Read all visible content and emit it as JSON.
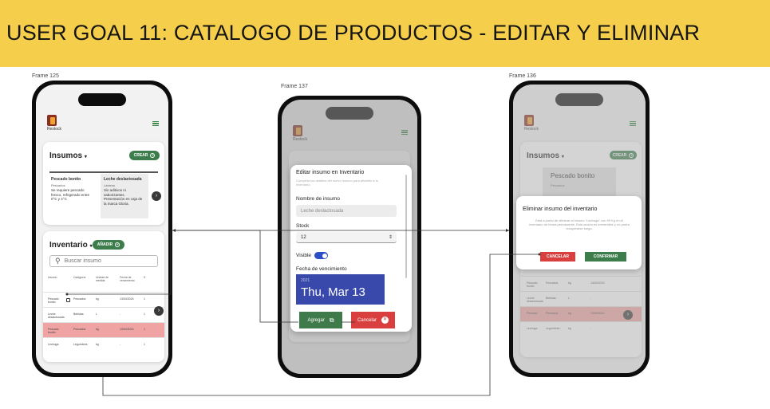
{
  "banner": {
    "title": "USER GOAL 11: CATALOGO DE PRODUCTOS - EDITAR Y ELIMINAR"
  },
  "frames": {
    "frame1_label": "Frame 125",
    "frame2_label": "Frame 137",
    "frame3_label": "Frame 136"
  },
  "app": {
    "logo_text": "Restock"
  },
  "screen1": {
    "insumos_title": "Insumos",
    "crear_label": "CREAR",
    "card1_title": "Pescado bonito",
    "card1_category": "Pescados",
    "card1_desc": "Se requiere pescado fresco, refrigerado entre 0°C y 4°C",
    "card2_title": "Leche deslactosada",
    "card2_category": "Lácteos",
    "card2_desc": "Sin aditivos ni saborizantes. Presentación en caja de la marca Gloria.",
    "inventario_title": "Inventario",
    "anadir_label": "AÑADIR",
    "search_placeholder": "Buscar insumo",
    "table_headers": [
      "Insumo",
      "Categoría",
      "Unidad de medida",
      "Fecha de vencimiento",
      "S"
    ],
    "rows": [
      {
        "insumo": "Pescado bonito",
        "categoria": "Pescados",
        "unidad": "kg",
        "fecha": "13/04/2024",
        "s": "1"
      },
      {
        "insumo": "Leche deslactosada",
        "categoria": "Bebidas",
        "unidad": "L",
        "fecha": "-",
        "s": "1"
      },
      {
        "insumo": "Pescado bonito",
        "categoria": "Pescados",
        "unidad": "kg",
        "fecha": "13/04/2024",
        "s": "1"
      },
      {
        "insumo": "Lechuga",
        "categoria": "Legumbres",
        "unidad": "kg",
        "fecha": "-",
        "s": "1"
      }
    ]
  },
  "screen2": {
    "modal_title": "Editar insumo en Inventario",
    "modal_subtitle": "Completa los detalles del nuevo insumo para añadirlo a tu inventario.",
    "nombre_label": "Nombre de insumo",
    "nombre_value": "Leche deslactosada",
    "stock_label": "Stock",
    "stock_value": "12",
    "visible_label": "Visible",
    "fecha_label": "Fecha de vencimiento",
    "date_year": "2021",
    "date_value": "Thu, Mar 13",
    "agregar_label": "Agregar",
    "cancelar_label": "Cancelar"
  },
  "screen3": {
    "insumos_title": "Insumos",
    "crear_label": "CREAR",
    "card_title": "Pescado bonito",
    "card_category": "Pescados",
    "modal_title": "Eliminar insumo del inventario",
    "modal_text": "Está a punto de eliminar el insumo \"Lechuga\" con 99 Kg en el inventario de forma permanente. Esta acción es irreversible y no podrá recuperarse luego.",
    "cancelar_label": "CANCELAR",
    "confirmar_label": "CONFIRMAR",
    "table_headers": [
      "Insumo",
      "Categoría",
      "Unidad de medida",
      "Fecha de vencimiento",
      "Stock"
    ],
    "rows": [
      {
        "insumo": "Pescado bonito",
        "categoria": "Pescados",
        "unidad": "kg",
        "fecha": "13/04/2024"
      },
      {
        "insumo": "Leche deslactosada",
        "categoria": "Bebidas",
        "unidad": "L",
        "fecha": "-"
      },
      {
        "insumo": "Pescado",
        "categoria": "Pescados",
        "unidad": "kg",
        "fecha": "13/04/2024"
      },
      {
        "insumo": "Lechuga",
        "categoria": "Legumbres",
        "unidad": "kg",
        "fecha": "-"
      }
    ]
  },
  "colors": {
    "banner": "#f5cf4b",
    "green": "#3c7d4b",
    "red": "#d93f3f",
    "toggle_blue": "#2d4fc6",
    "date_blue": "#3949ab",
    "highlight_row": "#f0a3a3"
  }
}
